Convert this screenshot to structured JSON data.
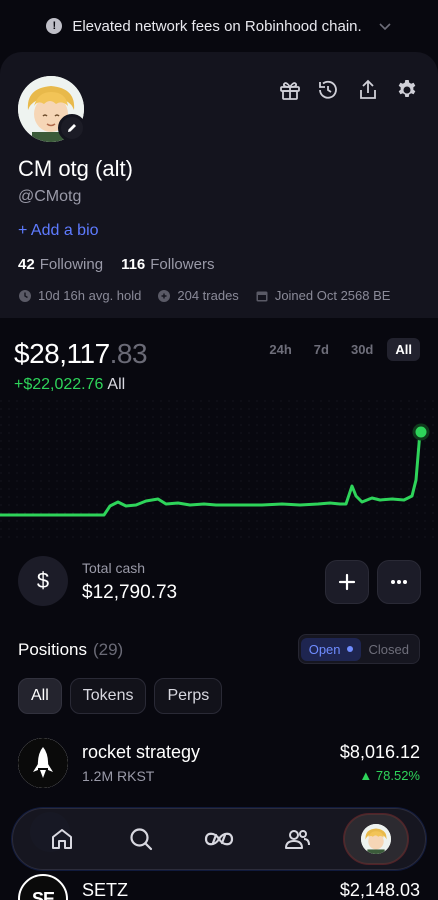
{
  "banner": {
    "text": "Elevated network fees on Robinhood chain."
  },
  "profile": {
    "display_name": "CM otg (alt)",
    "handle": "@CMotg",
    "add_bio": "+ Add a bio",
    "following_count": "42",
    "following_label": "Following",
    "followers_count": "116",
    "followers_label": "Followers",
    "stats": {
      "avg_hold": "10d 16h avg. hold",
      "trades": "204 trades",
      "joined": "Joined Oct 2568 BE"
    }
  },
  "portfolio": {
    "value_whole": "$28,117",
    "value_cents": ".83",
    "change": "+$22,022.76",
    "change_label": "All",
    "ranges": [
      "24h",
      "7d",
      "30d",
      "All"
    ],
    "active_range": "All"
  },
  "cash": {
    "label": "Total cash",
    "value": "$12,790.73",
    "symbol": "$"
  },
  "positions": {
    "title": "Positions",
    "count": "(29)",
    "toggle": {
      "open": "Open",
      "closed": "Closed"
    },
    "filters": [
      "All",
      "Tokens",
      "Perps"
    ],
    "rows": [
      {
        "name": "rocket strategy",
        "sub": "1.2M RKST",
        "value": "$8,016.12",
        "change": "▲ 78.52%"
      },
      {
        "name": "SETZ",
        "sub": "",
        "value": "$2,148.03",
        "change": ""
      }
    ]
  },
  "colors": {
    "accent_green": "#2ed45a",
    "accent_blue": "#5e7bff",
    "background": "#08080f"
  },
  "icons": [
    "info-icon",
    "chevron-down-icon",
    "gift-icon",
    "history-icon",
    "share-icon",
    "gear-icon",
    "pencil-icon",
    "clock-icon",
    "coin-icon",
    "calendar-icon",
    "home-icon",
    "search-icon",
    "infinity-icon",
    "users-icon"
  ]
}
